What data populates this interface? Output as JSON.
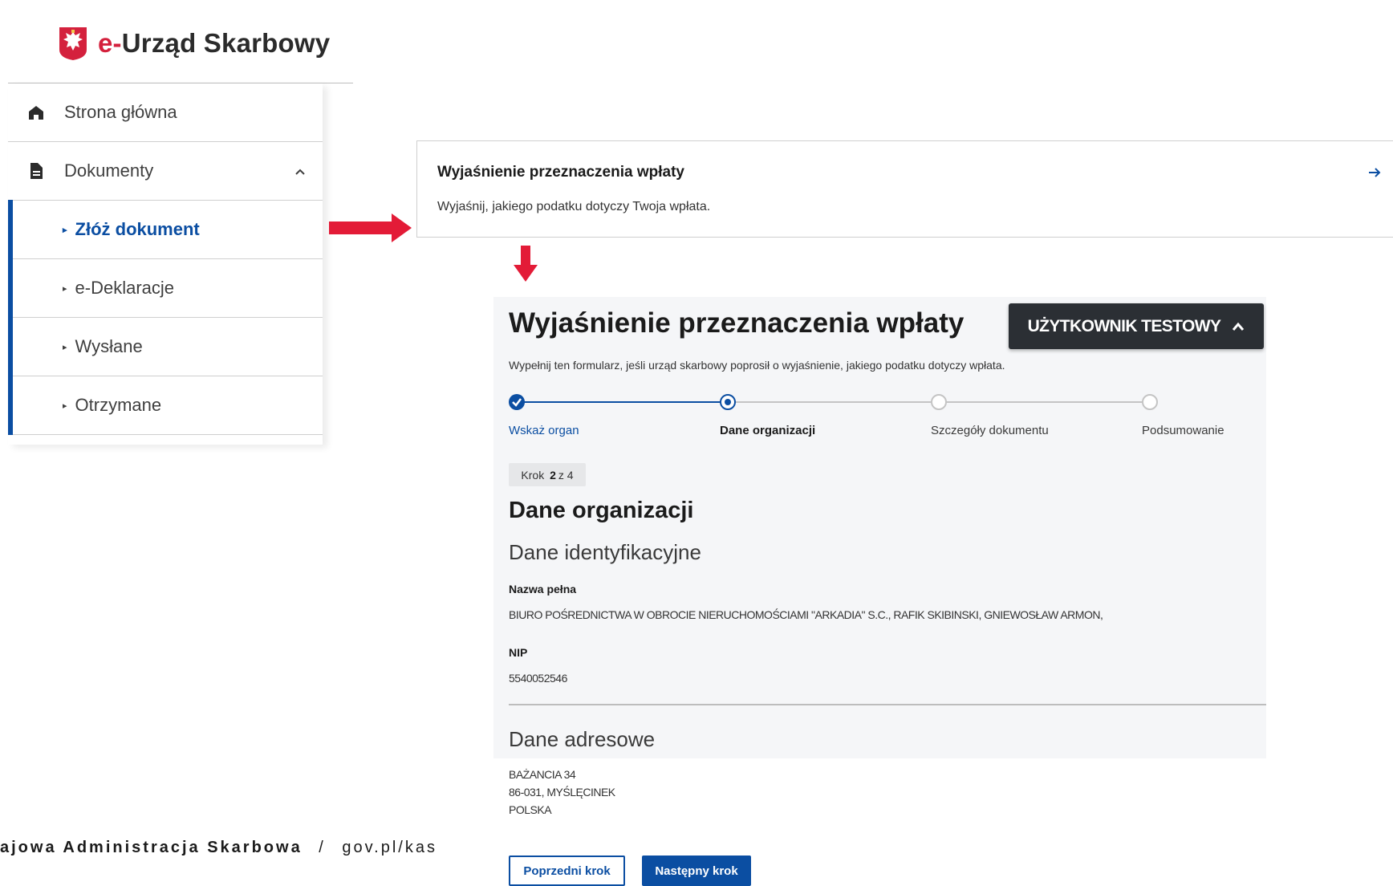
{
  "logo": {
    "prefix": "e-",
    "name": "Urząd Skarbowy"
  },
  "sidebar": {
    "items": [
      {
        "label": "Strona główna",
        "icon": "home-icon"
      },
      {
        "label": "Dokumenty",
        "icon": "document-icon"
      }
    ],
    "subitems": [
      {
        "label": "Złóż dokument"
      },
      {
        "label": "e-Deklaracje"
      },
      {
        "label": "Wysłane"
      },
      {
        "label": "Otrzymane"
      }
    ]
  },
  "card": {
    "title": "Wyjaśnienie przeznaczenia wpłaty",
    "description": "Wyjaśnij, jakiego podatku dotyczy Twoja wpłata."
  },
  "form": {
    "title": "Wyjaśnienie przeznaczenia wpłaty",
    "user_button": "UŻYTKOWNIK TESTOWY",
    "description": "Wypełnij ten formularz, jeśli urząd skarbowy poprosił o wyjaśnienie, jakiego podatku dotyczy wpłata.",
    "steps": [
      {
        "label": "Wskaż organ"
      },
      {
        "label": "Dane organizacji"
      },
      {
        "label": "Szczegóły dokumentu"
      },
      {
        "label": "Podsumowanie"
      }
    ],
    "badge": {
      "prefix": "Krok",
      "current": "2",
      "sep": "z",
      "total": "4"
    },
    "section_title": "Dane organizacji",
    "ident_heading": "Dane identyfikacyjne",
    "name_label": "Nazwa pełna",
    "name_value": "BIURO POŚREDNICTWA W OBROCIE NIERUCHOMOŚCIAMI \"ARKADIA\" S.C., RAFIK SKIBINSKI, GNIEWOSŁAW ARMON,",
    "nip_label": "NIP",
    "nip_value": "5540052546",
    "address_heading": "Dane adresowe",
    "address_lines": [
      "BAŻANCIA 34",
      "86-031, MYŚLĘCINEK",
      "POLSKA"
    ],
    "prev_button": "Poprzedni krok",
    "next_button": "Następny krok"
  },
  "footer": {
    "org": "ajowa Administracja Skarbowa",
    "sep": "/",
    "url": "gov.pl/kas"
  },
  "colors": {
    "brand_red": "#d4213d",
    "accent_blue": "#0b4ea2",
    "arrow_red": "#e31b37",
    "dark_button": "#2b2f34"
  }
}
